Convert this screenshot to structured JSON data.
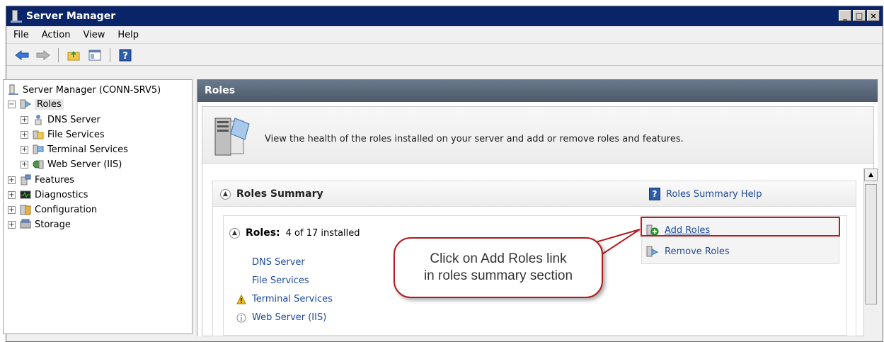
{
  "window": {
    "title": "Server Manager",
    "controls": [
      "_",
      "□",
      "×"
    ]
  },
  "menu": [
    "File",
    "Action",
    "View",
    "Help"
  ],
  "toolbar": {
    "icons": [
      "back-arrow-icon",
      "forward-arrow-icon",
      "folder-up-icon",
      "show-hide-tree-icon",
      "help-icon"
    ]
  },
  "tree": {
    "root": "Server Manager (CONN-SRV5)",
    "roles": "Roles",
    "role_children": [
      "DNS Server",
      "File Services",
      "Terminal Services",
      "Web Server (IIS)"
    ],
    "others": [
      "Features",
      "Diagnostics",
      "Configuration",
      "Storage"
    ]
  },
  "panel": {
    "header": "Roles",
    "description": "View the health of the roles installed on your server and add or remove roles and features."
  },
  "summary": {
    "title": "Roles Summary",
    "help_link": "Roles Summary Help",
    "roles_label": "Roles:",
    "roles_count": "4 of 17 installed",
    "roles": [
      {
        "name": "DNS Server",
        "status": ""
      },
      {
        "name": "File Services",
        "status": ""
      },
      {
        "name": "Terminal Services",
        "status": "warning"
      },
      {
        "name": "Web Server (IIS)",
        "status": "info"
      }
    ],
    "actions": {
      "add": "Add Roles",
      "remove": "Remove Roles"
    }
  },
  "callout": {
    "line1": "Click on Add Roles link",
    "line2": "in roles summary section"
  },
  "colors": {
    "title_bar": "#0a246a",
    "link": "#1d4a9c",
    "highlight": "#c01a1a",
    "header": "#5a6878"
  }
}
